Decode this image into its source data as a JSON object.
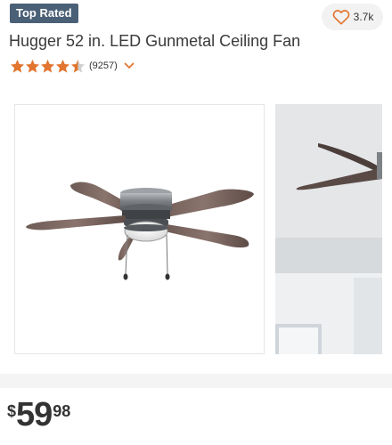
{
  "badge": {
    "label": "Top Rated"
  },
  "favorite": {
    "count": "3.7k",
    "icon": "heart-outline-icon"
  },
  "product": {
    "title": "Hugger 52 in. LED Gunmetal Ceiling Fan"
  },
  "rating": {
    "stars": 4.5,
    "max": 5,
    "reviews": "(9257)",
    "star_color": "#e2752f",
    "empty_color": "#cfcfcf"
  },
  "gallery": {
    "images": [
      "ceiling-fan-product-image",
      "ceiling-fan-room-image"
    ]
  },
  "price": {
    "currency": "$",
    "dollars": "59",
    "cents": "98"
  },
  "colors": {
    "badge_bg": "#4a6076",
    "accent": "#e2752f"
  }
}
